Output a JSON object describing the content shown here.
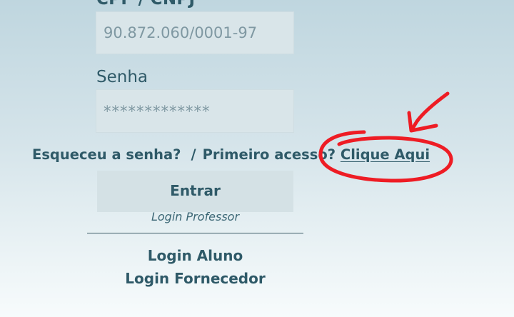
{
  "form": {
    "cpf_label": "CPF / CNPJ",
    "cpf_value": "90.872.060/0001-97",
    "senha_label": "Senha",
    "senha_value": "*************"
  },
  "help": {
    "forgot_password": "Esqueceu a senha?",
    "separator": "/",
    "first_access": "Primeiro acesso?",
    "click_here": "Clique Aqui"
  },
  "actions": {
    "enter_label": "Entrar",
    "login_professor": "Login Professor",
    "login_aluno": "Login Aluno",
    "login_fornecedor": "Login Fornecedor"
  },
  "annotation": {
    "color": "#ee1c24",
    "shapes": [
      "circle-annotation",
      "arrow-annotation"
    ]
  },
  "colors": {
    "text": "#2f5a68",
    "input_bg": "#d9e5e9",
    "placeholder": "#7f98a2"
  }
}
